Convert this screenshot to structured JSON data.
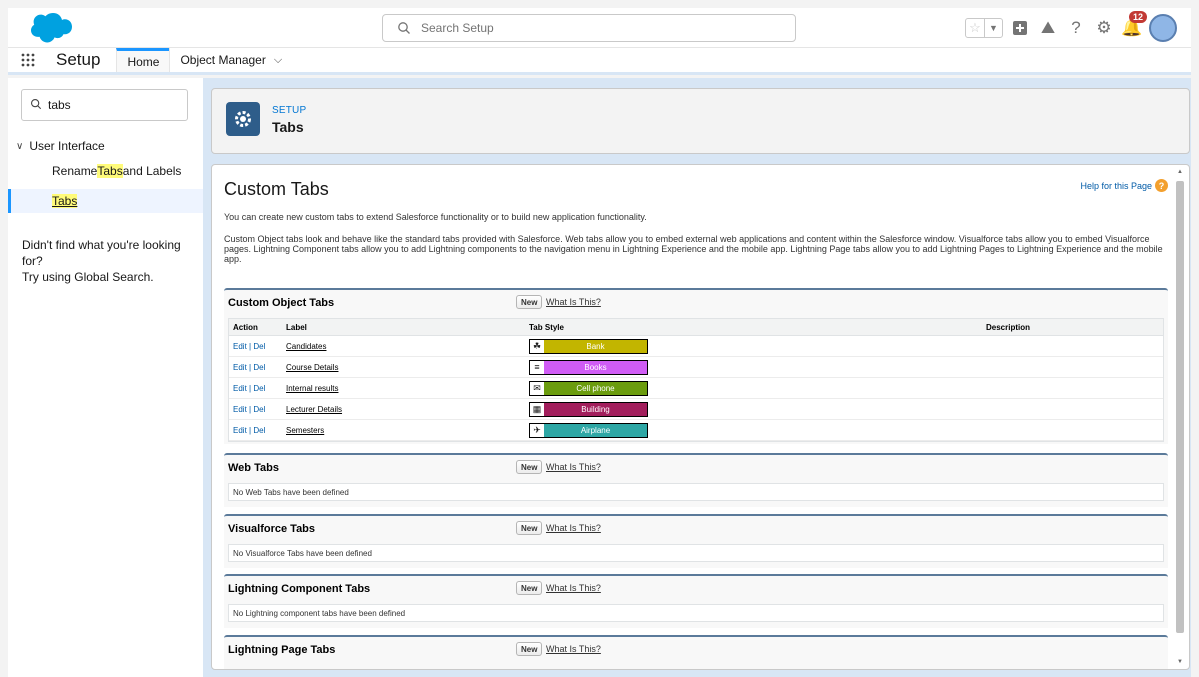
{
  "header": {
    "search_placeholder": "Search Setup",
    "notification_count": "12"
  },
  "context_bar": {
    "app_name": "Setup",
    "tabs": [
      {
        "label": "Home"
      },
      {
        "label": "Object Manager"
      }
    ]
  },
  "sidebar": {
    "quickfind_value": "tabs",
    "group_label": "User Interface",
    "items": [
      {
        "prefix": "Rename ",
        "match": "Tabs",
        "suffix": " and Labels"
      },
      {
        "prefix": "",
        "match": "Tabs",
        "suffix": ""
      }
    ],
    "no_find_line1": "Didn't find what you're looking for?",
    "no_find_line2": "Try using Global Search."
  },
  "page_header": {
    "kicker": "SETUP",
    "title": "Tabs"
  },
  "content": {
    "title": "Custom Tabs",
    "help_link": "Help for this Page",
    "intro1": "You can create new custom tabs to extend Salesforce functionality or to build new application functionality.",
    "intro2": "Custom Object tabs look and behave like the standard tabs provided with Salesforce. Web tabs allow you to embed external web applications and content within the Salesforce window. Visualforce tabs allow you to embed Visualforce pages. Lightning Component tabs allow you to add Lightning components to the navigation menu in Lightning Experience and the mobile app. Lightning Page tabs allow you to add Lightning Pages to Lightning Experience and the mobile app."
  },
  "buttons": {
    "new": "New",
    "what_is_this": "What Is This?"
  },
  "custom_object_tabs": {
    "title": "Custom Object Tabs",
    "columns": {
      "action": "Action",
      "label": "Label",
      "tab_style": "Tab Style",
      "description": "Description"
    },
    "edit_label": "Edit",
    "separator": " | ",
    "del_label": "Del",
    "rows": [
      {
        "label": "Candidates",
        "style": "Bank",
        "color": "#c2b500",
        "icon": "bank-icon",
        "glyph": "☘"
      },
      {
        "label": "Course Details",
        "style": "Books",
        "color": "#d05cf5",
        "icon": "books-icon",
        "glyph": "≡"
      },
      {
        "label": "Internal results",
        "style": "Cell phone",
        "color": "#6b9c0e",
        "icon": "cell-phone-icon",
        "glyph": "✉"
      },
      {
        "label": "Lecturer Details",
        "style": "Building",
        "color": "#a21e5c",
        "icon": "building-icon",
        "glyph": "▦"
      },
      {
        "label": "Semesters",
        "style": "Airplane",
        "color": "#2ea7a5",
        "icon": "airplane-icon",
        "glyph": "✈"
      }
    ]
  },
  "web_tabs": {
    "title": "Web Tabs",
    "empty": "No Web Tabs have been defined"
  },
  "visualforce_tabs": {
    "title": "Visualforce Tabs",
    "empty": "No Visualforce Tabs have been defined"
  },
  "lightning_component_tabs": {
    "title": "Lightning Component Tabs",
    "empty": "No Lightning component tabs have been defined"
  },
  "lightning_page_tabs": {
    "title": "Lightning Page Tabs"
  }
}
